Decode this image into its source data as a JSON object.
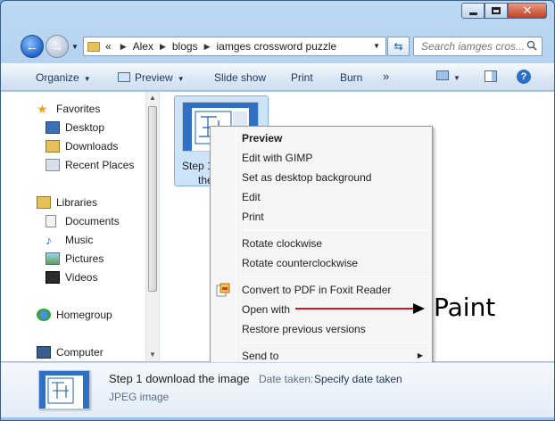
{
  "window": {
    "caption": {
      "minimize": "minimize",
      "maximize": "maximize",
      "close": "✕"
    }
  },
  "address": {
    "prefix": "«",
    "crumbs": [
      "Alex",
      "blogs",
      "iamges crossword puzzle"
    ]
  },
  "search": {
    "placeholder": "Search iamges cros..."
  },
  "toolbar": {
    "organize": "Organize",
    "preview": "Preview",
    "slideshow": "Slide show",
    "print": "Print",
    "burn": "Burn",
    "more": "»"
  },
  "sidebar": {
    "favorites": "Favorites",
    "desktop": "Desktop",
    "downloads": "Downloads",
    "recent": "Recent Places",
    "libraries": "Libraries",
    "documents": "Documents",
    "music": "Music",
    "pictures": "Pictures",
    "videos": "Videos",
    "homegroup": "Homegroup",
    "computer": "Computer"
  },
  "file": {
    "label_line1": "Step 1",
    "label_line2": "the"
  },
  "context_menu": {
    "preview": "Preview",
    "edit_gimp": "Edit with GIMP",
    "set_bg": "Set as desktop background",
    "edit": "Edit",
    "print": "Print",
    "rotate_cw": "Rotate clockwise",
    "rotate_ccw": "Rotate counterclockwise",
    "convert_pdf": "Convert to PDF in Foxit Reader",
    "open_with": "Open with",
    "restore": "Restore previous versions",
    "send_to": "Send to"
  },
  "annotation": {
    "text": "Paint",
    "line_color": "#d0181c"
  },
  "details": {
    "name": "Step 1 download the image",
    "date_label": "Date taken:",
    "date_value": "Specify date taken",
    "type": "JPEG image"
  }
}
